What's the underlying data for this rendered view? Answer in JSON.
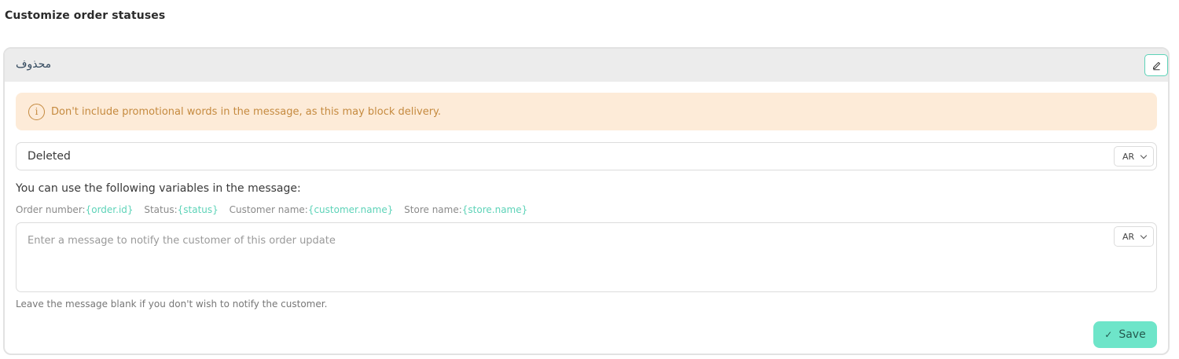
{
  "page": {
    "title": "Customize order statuses"
  },
  "card": {
    "header_title": "محذوف",
    "alert_text": "Don't include promotional words in the message, as this may block delivery.",
    "status_name_value": "Deleted",
    "status_name_lang": "AR",
    "variables_title": "You can use the following variables in the message:",
    "variables": [
      {
        "label": "Order number:",
        "token": "{order.id}"
      },
      {
        "label": "Status:",
        "token": "{status}"
      },
      {
        "label": "Customer name:",
        "token": "{customer.name}"
      },
      {
        "label": "Store name:",
        "token": "{store.name}"
      }
    ],
    "message_placeholder": "Enter a message to notify the customer of this order update",
    "message_lang": "AR",
    "hint": "Leave the message blank if you don't wish to notify the customer.",
    "save_label": "Save"
  },
  "icons": {
    "edit": "pencil-icon",
    "info": "info-icon",
    "chevron": "chevron-down-icon",
    "check": "check-icon"
  },
  "colors": {
    "accent": "#6ee5c9",
    "token": "#5dd3b8",
    "alert_bg": "#fdebd8",
    "alert_text": "#c58a3f"
  }
}
